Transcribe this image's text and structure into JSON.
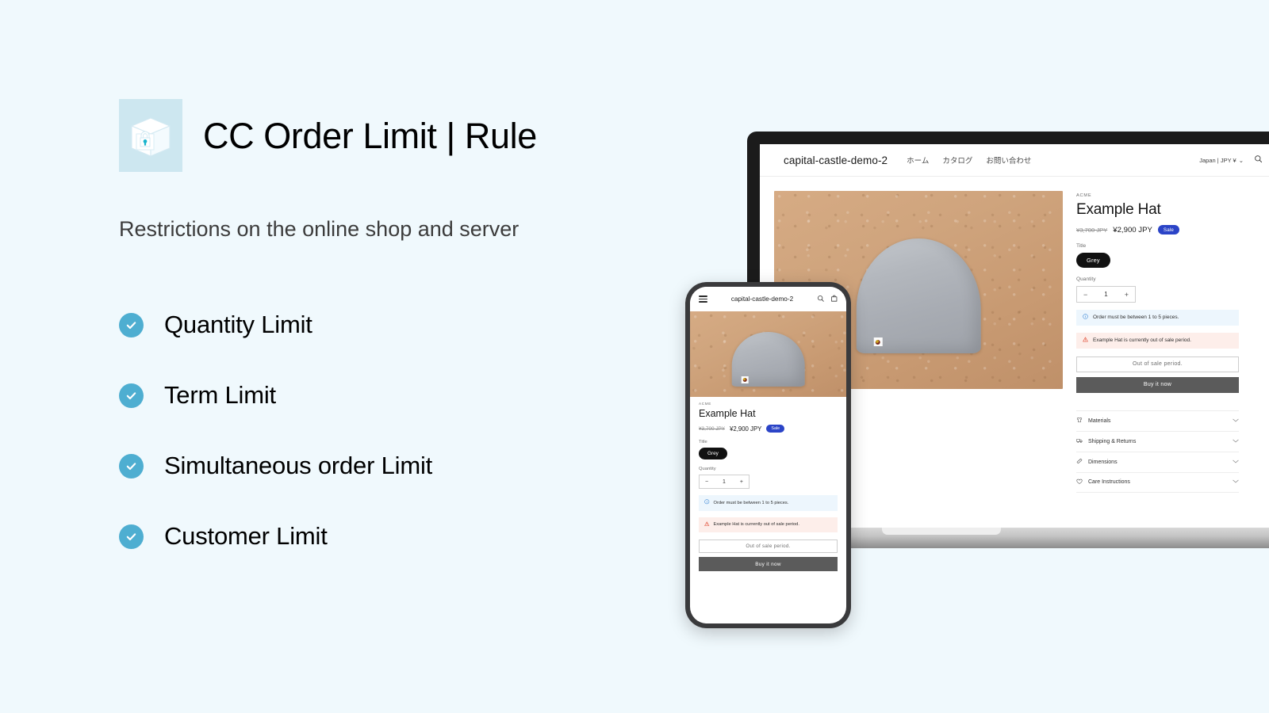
{
  "slide": {
    "background_color": "#f0f9fd",
    "title": "CC Order Limit | Rule",
    "subtitle": "Restrictions on the online shop and server",
    "app_icon_name": "locked-box-icon",
    "accent_color": "#4eaed1",
    "icon_tile_color": "#cde7f0"
  },
  "features": [
    {
      "label": "Quantity Limit"
    },
    {
      "label": "Term Limit"
    },
    {
      "label": "Simultaneous order Limit"
    },
    {
      "label": "Customer Limit"
    }
  ],
  "desktop": {
    "header": {
      "brand": "capital-castle-demo-2",
      "nav": [
        {
          "label": "ホーム"
        },
        {
          "label": "カタログ"
        },
        {
          "label": "お問い合わせ"
        }
      ],
      "locale": "Japan | JPY ¥",
      "locale_chevron": "⌄",
      "search_icon": "search-icon",
      "cart_icon": "cart-icon"
    },
    "product": {
      "vendor": "ACME",
      "title": "Example Hat",
      "price_compare": "¥3,700 JPY",
      "price_current": "¥2,900 JPY",
      "sale_badge": "Sale",
      "variant_label": "Title",
      "variant_value": "Grey",
      "quantity_label": "Quantity",
      "quantity_value": "1",
      "qty_minus": "−",
      "qty_plus": "+",
      "notice_info": "Order must be between 1 to 5 pieces.",
      "notice_warning": "Example Hat is currently out of sale period.",
      "add_to_cart_label": "Out of sale period.",
      "buy_now_label": "Buy it now",
      "image_alt": "grey beanie hat on kraft paper background"
    },
    "accordion": [
      {
        "label": "Materials",
        "icon": "shirt-icon"
      },
      {
        "label": "Shipping & Returns",
        "icon": "truck-icon"
      },
      {
        "label": "Dimensions",
        "icon": "ruler-icon"
      },
      {
        "label": "Care Instructions",
        "icon": "heart-icon"
      }
    ]
  },
  "mobile": {
    "header": {
      "brand": "capital-castle-demo-2",
      "menu_icon": "hamburger-menu-icon",
      "search_icon": "search-icon",
      "cart_icon": "cart-icon"
    },
    "product": {
      "vendor": "ACME",
      "title": "Example Hat",
      "price_compare": "¥3,700 JPY",
      "price_current": "¥2,900 JPY",
      "sale_badge": "Sale",
      "variant_label": "Title",
      "variant_value": "Grey",
      "quantity_label": "Quantity",
      "quantity_value": "1",
      "qty_minus": "−",
      "qty_plus": "+",
      "notice_info": "Order must be between 1 to 5 pieces.",
      "notice_warning": "Example Hat is currently out of sale period.",
      "add_to_cart_label": "Out of sale period.",
      "buy_now_label": "Buy it now"
    }
  }
}
